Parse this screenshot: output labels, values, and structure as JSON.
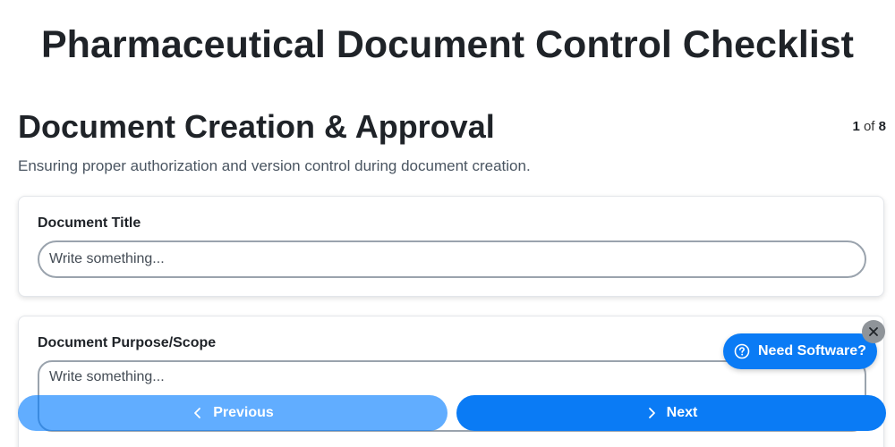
{
  "page": {
    "title": "Pharmaceutical Document Control Checklist"
  },
  "section": {
    "title": "Document Creation & Approval",
    "description": "Ensuring proper authorization and version control during document creation.",
    "step_current": "1",
    "step_of": "of",
    "step_total": "8"
  },
  "fields": [
    {
      "label": "Document Title",
      "placeholder": "Write something..."
    },
    {
      "label": "Document Purpose/Scope",
      "placeholder": "Write something..."
    }
  ],
  "navigation": {
    "previous_label": "Previous",
    "next_label": "Next"
  },
  "help_widget": {
    "label": "Need Software?"
  },
  "icons": {
    "previous": "chevron-left-icon",
    "next": "chevron-right-icon",
    "help": "question-circle-icon",
    "close": "close-icon"
  },
  "colors": {
    "primary": "#0a7bf5",
    "primary_disabled": "#5aa7fa",
    "close_badge": "#8f9499"
  }
}
